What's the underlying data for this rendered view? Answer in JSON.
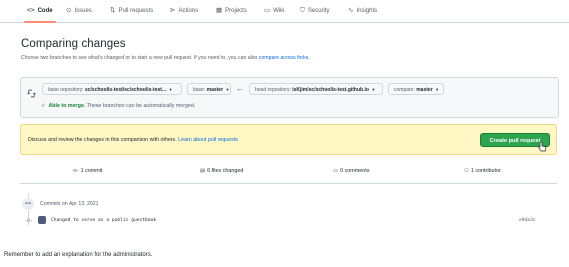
{
  "nav": {
    "tabs": [
      {
        "label": "Code",
        "icon": "code-icon",
        "glyph": "<>"
      },
      {
        "label": "Issues",
        "icon": "issue-icon",
        "glyph": "⊙"
      },
      {
        "label": "Pull requests",
        "icon": "pull-request-icon",
        "glyph": "⇅"
      },
      {
        "label": "Actions",
        "icon": "actions-icon",
        "glyph": "⊳"
      },
      {
        "label": "Projects",
        "icon": "projects-icon",
        "glyph": "▦"
      },
      {
        "label": "Wiki",
        "icon": "wiki-icon",
        "glyph": "▭"
      },
      {
        "label": "Security",
        "icon": "shield-icon",
        "glyph": "⛉"
      },
      {
        "label": "Insights",
        "icon": "graph-icon",
        "glyph": "∿"
      }
    ],
    "active_tab": "Code"
  },
  "heading": {
    "title": "Comparing changes",
    "subtitle": "Choose two branches to see what's changed or to start a new pull request. If you need to, you can also",
    "subtitle_link": "compare across forks."
  },
  "compare": {
    "base_repo_key": "base repository:",
    "base_repo_value": "sc/schoolis-test/sc/schoolis-test...",
    "base_key": "base:",
    "base_value": "master",
    "head_repo_key": "head repository:",
    "head_repo_value": "isKjim/sc/schoolis-test.github.io",
    "compare_key": "compare:",
    "compare_value": "master",
    "merge_ok": "Able to merge.",
    "merge_rest": "These branches can be automatically merged."
  },
  "flash": {
    "message": "Discuss and review the changes in this comparison with others.",
    "link": "Learn about pull requests",
    "button": "Create pull request"
  },
  "stats": {
    "commits": "1 commit",
    "files": "6 files changed",
    "comments": "0 comments",
    "contributors": "1 contributor"
  },
  "commits": {
    "date": "Commits on Apr 13, 2021",
    "message": "Changed to serve as a public guestbook",
    "sha": "e9da3c"
  },
  "footer": {
    "text": "Remember to add an explanation for the administrators."
  },
  "colors": {
    "primary_button": "#2da44e",
    "flash_bg": "#fff8c5",
    "link": "#0969da",
    "active_tab_underline": "#fd8c73"
  }
}
